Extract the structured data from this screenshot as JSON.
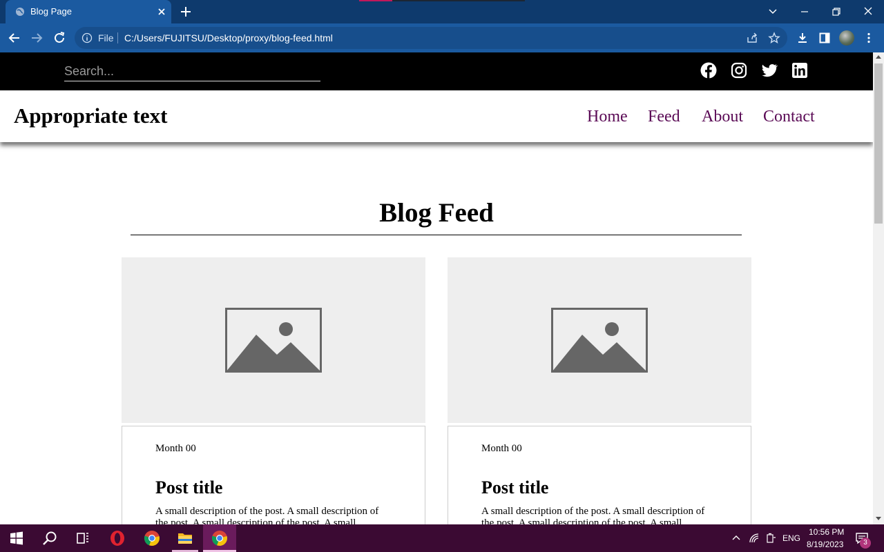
{
  "browser": {
    "tab_title": "Blog Page",
    "omnibox_scheme": "File",
    "url": "C:/Users/FUJITSU/Desktop/proxy/blog-feed.html",
    "icons": [
      "globe-icon",
      "close-icon",
      "plus-icon",
      "chevron-down-icon",
      "minimize-icon",
      "restore-icon",
      "close-icon",
      "back-icon",
      "forward-icon",
      "reload-icon",
      "info-icon",
      "share-icon",
      "star-icon",
      "download-icon",
      "sidepanel-icon",
      "avatar",
      "kebab-icon"
    ]
  },
  "page": {
    "search": {
      "placeholder": "Search..."
    },
    "social_icons": [
      "facebook-icon",
      "instagram-icon",
      "twitter-icon",
      "linkedin-icon"
    ],
    "brand": "Appropriate text",
    "nav": [
      "Home",
      "Feed",
      "About",
      "Contact"
    ],
    "nav_color": "#5a0a55",
    "feed_heading": "Blog Feed",
    "posts": [
      {
        "date": "Month 00",
        "title": "Post title",
        "description": "A small description of the post. A small description of the post. A small description of the post. A small"
      },
      {
        "date": "Month 00",
        "title": "Post title",
        "description": "A small description of the post. A small description of the post. A small description of the post. A small"
      }
    ]
  },
  "taskbar": {
    "apps": [
      "windows-start-icon",
      "search-icon",
      "task-view-icon",
      "opera-icon",
      "chrome-icon",
      "file-explorer-icon",
      "chrome-active-icon"
    ],
    "language": "ENG",
    "time": "10:56 PM",
    "date": "8/19/2023",
    "notifications": "3",
    "background": "#3b0a33"
  }
}
